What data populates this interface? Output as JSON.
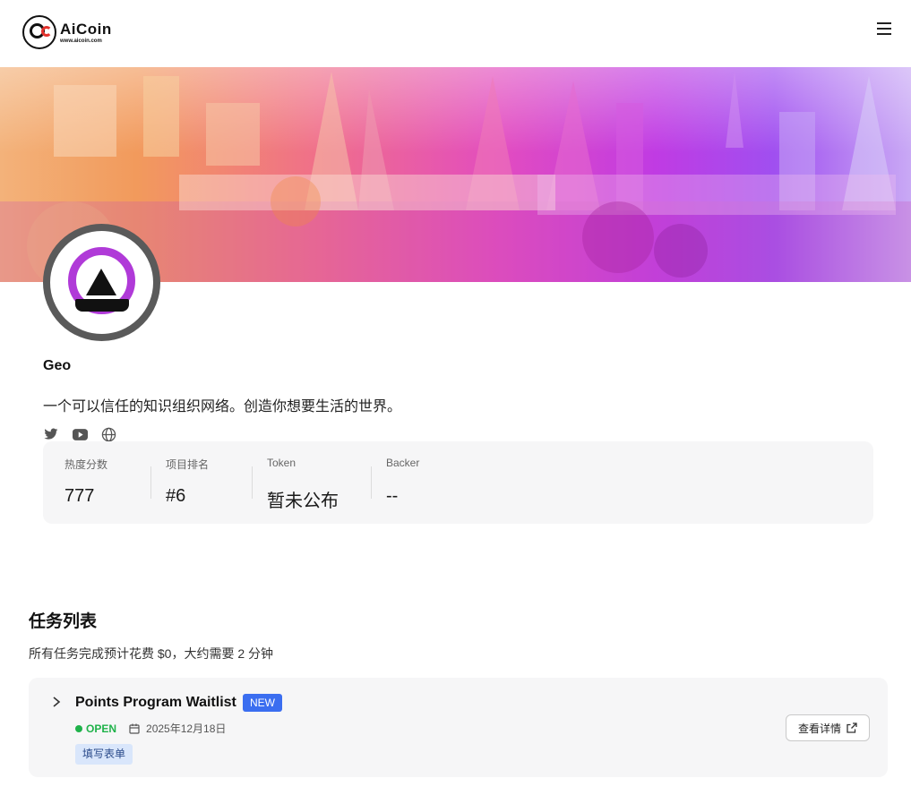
{
  "header": {
    "logo_name": "AiCoin",
    "logo_url": "www.aicoin.com",
    "menu_icon": "hamburger-menu-icon"
  },
  "profile": {
    "name": "Geo",
    "description": "一个可以信任的知识组织网络。创造你想要生活的世界。",
    "socials": [
      "twitter-icon",
      "youtube-icon",
      "globe-icon"
    ]
  },
  "stats": [
    {
      "label": "热度分数",
      "value": "777"
    },
    {
      "label": "项目排名",
      "value": "#6"
    },
    {
      "label": "Token",
      "value": "暂未公布"
    },
    {
      "label": "Backer",
      "value": "--"
    }
  ],
  "tasks": {
    "title": "任务列表",
    "subtitle": "所有任务完成预计花费 $0，大约需要 2 分钟",
    "items": [
      {
        "name": "Points Program Waitlist",
        "badge": "NEW",
        "status": "OPEN",
        "date": "2025年12月18日",
        "tag": "填写表单",
        "action": "查看详情"
      }
    ]
  },
  "colors": {
    "accent": "#3b6ef0",
    "open": "#1fb24a",
    "avatar_ring": "#b03ad8"
  }
}
